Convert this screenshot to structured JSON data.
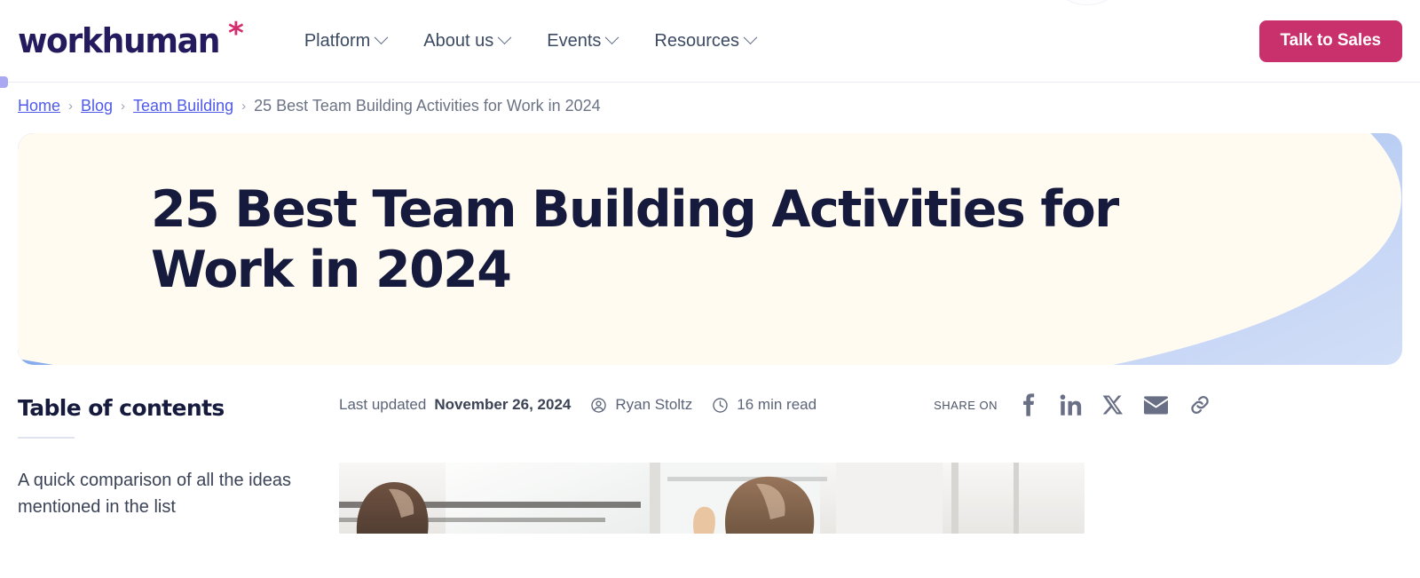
{
  "header": {
    "logo_text": "workhuman",
    "logo_mark": "*",
    "nav": [
      {
        "label": "Platform",
        "icon": "chevron-down-icon"
      },
      {
        "label": "About us",
        "icon": "chevron-down-icon"
      },
      {
        "label": "Events",
        "icon": "chevron-down-icon"
      },
      {
        "label": "Resources",
        "icon": "chevron-down-icon"
      }
    ],
    "cta_label": "Talk to Sales",
    "cta_color": "#c9316c"
  },
  "breadcrumb": {
    "items": [
      {
        "label": "Home",
        "is_link": true
      },
      {
        "label": "Blog",
        "is_link": true
      },
      {
        "label": "Team Building",
        "is_link": true
      },
      {
        "label": "25 Best Team Building Activities for Work in 2024",
        "is_link": false
      }
    ],
    "separator": "›",
    "link_color": "#4f5ae8"
  },
  "hero": {
    "title": "25 Best Team Building Activities for Work in 2024",
    "background_cream": "#fffbf1",
    "background_blue": "#6f9ae8",
    "background_base": "#e9edfa",
    "title_color": "#161b3d"
  },
  "toc": {
    "heading": "Table of contents",
    "entries": [
      "A quick comparison of all the ideas mentioned in the list"
    ]
  },
  "meta": {
    "updated_prefix": "Last updated",
    "updated_date": "November 26, 2024",
    "author_icon": "user-circle-icon",
    "author": "Ryan Stoltz",
    "read_icon": "clock-icon",
    "read_time": "16 min read"
  },
  "share": {
    "label": "SHARE ON",
    "icons": [
      {
        "name": "facebook-icon",
        "title": "Facebook"
      },
      {
        "name": "linkedin-icon",
        "title": "LinkedIn"
      },
      {
        "name": "x-twitter-icon",
        "title": "X"
      },
      {
        "name": "email-icon",
        "title": "Email"
      },
      {
        "name": "link-icon",
        "title": "Copy link"
      }
    ],
    "icon_color": "#696f85"
  },
  "article": {
    "photo_alt": "Coworkers talking in a bright modern office"
  }
}
